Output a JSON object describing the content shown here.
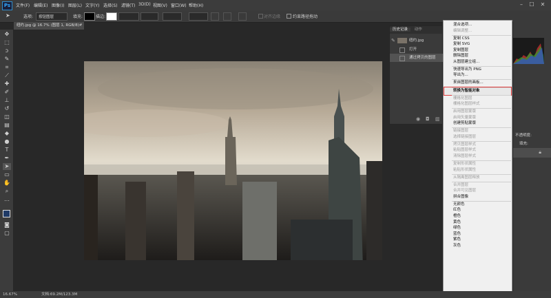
{
  "app": {
    "logo": "Ps"
  },
  "menubar": {
    "items": [
      {
        "label": "文件(F)"
      },
      {
        "label": "编辑(E)"
      },
      {
        "label": "图像(I)"
      },
      {
        "label": "图层(L)"
      },
      {
        "label": "文字(Y)"
      },
      {
        "label": "选择(S)"
      },
      {
        "label": "滤镜(T)"
      },
      {
        "label": "3D(D)"
      },
      {
        "label": "视图(V)"
      },
      {
        "label": "窗口(W)"
      },
      {
        "label": "帮助(H)"
      }
    ],
    "window_controls": [
      "–",
      "☐",
      "✕"
    ]
  },
  "options_bar": {
    "select_label": "选项:",
    "select_value": "按钮图层",
    "fill_label": "填充:",
    "stroke_label": "描边:",
    "align_checkbox": "对齐边缘",
    "constrain_checkbox": "约束路径拖动"
  },
  "document": {
    "tab_title": "纽约.jpg @ 16.7% (图层 1, RGB/8) *",
    "tab_close": "×"
  },
  "status": {
    "zoom": "16.67%",
    "doc_size": "文档:69.2M/123.3M"
  },
  "history_panel": {
    "tabs": [
      "历史记录",
      "动作"
    ],
    "snapshot": "纽约.jpg",
    "items": [
      "打开",
      "通过拷贝的图层"
    ]
  },
  "context_menu": {
    "items": [
      {
        "label": "混合选项...",
        "disabled": false
      },
      {
        "label": "编辑调整...",
        "disabled": true
      },
      {
        "sep": true
      },
      {
        "label": "复制 CSS",
        "disabled": false
      },
      {
        "label": "复制 SVG",
        "disabled": false
      },
      {
        "label": "复制图层",
        "disabled": false
      },
      {
        "label": "删除图层",
        "disabled": false
      },
      {
        "label": "从图层建立组...",
        "disabled": false
      },
      {
        "sep": true
      },
      {
        "label": "快速导出为 PNG",
        "disabled": false
      },
      {
        "label": "导出为...",
        "disabled": false
      },
      {
        "sep": true
      },
      {
        "label": "来自图层的画板...",
        "disabled": false
      },
      {
        "sep": true
      },
      {
        "label": "转换为智能对象",
        "disabled": false,
        "highlight": true
      },
      {
        "sep": true
      },
      {
        "label": "栅格化图层",
        "disabled": true
      },
      {
        "label": "栅格化图层样式",
        "disabled": true
      },
      {
        "sep": true
      },
      {
        "label": "启用图层蒙版",
        "disabled": true
      },
      {
        "label": "启用矢量蒙版",
        "disabled": true
      },
      {
        "label": "创建剪贴蒙版",
        "disabled": false
      },
      {
        "sep": true
      },
      {
        "label": "链接图层",
        "disabled": true
      },
      {
        "label": "选择链接图层",
        "disabled": true
      },
      {
        "sep": true
      },
      {
        "label": "拷贝图层样式",
        "disabled": true
      },
      {
        "label": "粘贴图层样式",
        "disabled": true
      },
      {
        "label": "清除图层样式",
        "disabled": true
      },
      {
        "sep": true
      },
      {
        "label": "复制形状属性",
        "disabled": true
      },
      {
        "label": "粘贴形状属性",
        "disabled": true
      },
      {
        "sep": true
      },
      {
        "label": "从隔离图层释放",
        "disabled": true
      },
      {
        "sep": true
      },
      {
        "label": "合并图层",
        "disabled": true
      },
      {
        "label": "合并可见图层",
        "disabled": true
      },
      {
        "label": "拼合图像",
        "disabled": false
      },
      {
        "sep": true
      },
      {
        "label": "无颜色",
        "disabled": false
      },
      {
        "label": "红色",
        "disabled": false
      },
      {
        "label": "橙色",
        "disabled": false
      },
      {
        "label": "黄色",
        "disabled": false
      },
      {
        "label": "绿色",
        "disabled": false
      },
      {
        "label": "蓝色",
        "disabled": false
      },
      {
        "label": "紫色",
        "disabled": false
      },
      {
        "label": "灰色",
        "disabled": false
      }
    ]
  },
  "right_panel": {
    "opacity_label": "不透明度:",
    "fill_label": "填充:"
  },
  "colors": {
    "accent_blue": "#31a8ff",
    "highlight_border": "#e03a3a",
    "menu_bg": "#f0f0f0"
  }
}
